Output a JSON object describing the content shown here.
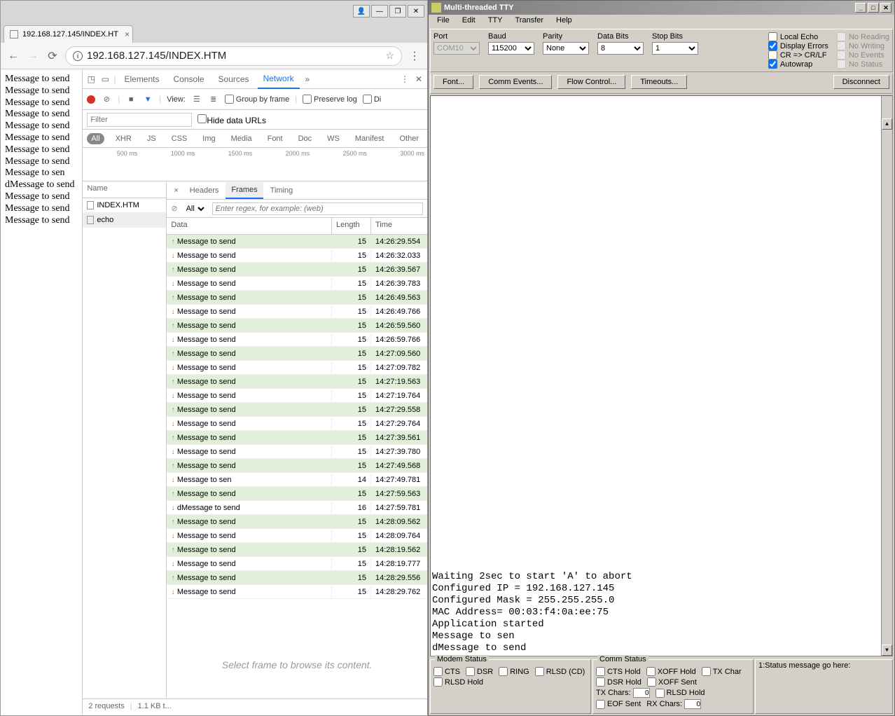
{
  "chrome": {
    "tab_title": "192.168.127.145/INDEX.HT",
    "url": "192.168.127.145/INDEX.HTM",
    "window_buttons": [
      "👤",
      "—",
      "❐",
      "✕"
    ],
    "nav": {
      "back": "←",
      "forward": "→",
      "reload": "⟳",
      "star": "☆",
      "menu": "⋮",
      "info": "ⓘ"
    },
    "page_lines": [
      "Message to send",
      "Message to send",
      "Message to send",
      "Message to send",
      "Message to send",
      "Message to send",
      "Message to send",
      "Message to send",
      "Message to sen",
      "dMessage to send",
      "Message to send",
      "Message to send",
      "Message to send"
    ]
  },
  "devtools": {
    "tabs": [
      "Elements",
      "Console",
      "Sources",
      "Network"
    ],
    "active_tab": "Network",
    "toolbar": {
      "view_label": "View:",
      "group_label": "Group by frame",
      "preserve_label": "Preserve log",
      "disable_label": "Di"
    },
    "filter_placeholder": "Filter",
    "hide_urls": "Hide data URLs",
    "type_filters": [
      "All",
      "XHR",
      "JS",
      "CSS",
      "Img",
      "Media",
      "Font",
      "Doc",
      "WS",
      "Manifest",
      "Other"
    ],
    "timeline": [
      "500 ms",
      "1000 ms",
      "1500 ms",
      "2000 ms",
      "2500 ms",
      "3000 ms"
    ],
    "request_header": "Name",
    "requests": [
      "INDEX.HTM",
      "echo"
    ],
    "selected_request": "echo",
    "detail_tabs": [
      "Headers",
      "Frames",
      "Timing"
    ],
    "active_detail": "Frames",
    "frame_filter": {
      "all": "All",
      "regex_placeholder": "Enter regex, for example: (web)"
    },
    "frame_headers": {
      "data": "Data",
      "length": "Length",
      "time": "Time"
    },
    "frames": [
      {
        "dir": "send",
        "data": "Message to send",
        "len": 15,
        "time": "14:26:29.554"
      },
      {
        "dir": "recv",
        "data": "Message to send",
        "len": 15,
        "time": "14:26:32.033"
      },
      {
        "dir": "send",
        "data": "Message to send",
        "len": 15,
        "time": "14:26:39.567"
      },
      {
        "dir": "recv",
        "data": "Message to send",
        "len": 15,
        "time": "14:26:39.783"
      },
      {
        "dir": "send",
        "data": "Message to send",
        "len": 15,
        "time": "14:26:49.563"
      },
      {
        "dir": "recv",
        "data": "Message to send",
        "len": 15,
        "time": "14:26:49.766"
      },
      {
        "dir": "send",
        "data": "Message to send",
        "len": 15,
        "time": "14:26:59.560"
      },
      {
        "dir": "recv",
        "data": "Message to send",
        "len": 15,
        "time": "14:26:59.766"
      },
      {
        "dir": "send",
        "data": "Message to send",
        "len": 15,
        "time": "14:27:09.560"
      },
      {
        "dir": "recv",
        "data": "Message to send",
        "len": 15,
        "time": "14:27:09.782"
      },
      {
        "dir": "send",
        "data": "Message to send",
        "len": 15,
        "time": "14:27:19.563"
      },
      {
        "dir": "recv",
        "data": "Message to send",
        "len": 15,
        "time": "14:27:19.764"
      },
      {
        "dir": "send",
        "data": "Message to send",
        "len": 15,
        "time": "14:27:29.558"
      },
      {
        "dir": "recv",
        "data": "Message to send",
        "len": 15,
        "time": "14:27:29.764"
      },
      {
        "dir": "send",
        "data": "Message to send",
        "len": 15,
        "time": "14:27:39.561"
      },
      {
        "dir": "recv",
        "data": "Message to send",
        "len": 15,
        "time": "14:27:39.780"
      },
      {
        "dir": "send",
        "data": "Message to send",
        "len": 15,
        "time": "14:27:49.568"
      },
      {
        "dir": "recv",
        "data": "Message to sen",
        "len": 14,
        "time": "14:27:49.781"
      },
      {
        "dir": "send",
        "data": "Message to send",
        "len": 15,
        "time": "14:27:59.563"
      },
      {
        "dir": "recv",
        "data": "dMessage to send",
        "len": 16,
        "time": "14:27:59.781"
      },
      {
        "dir": "send",
        "data": "Message to send",
        "len": 15,
        "time": "14:28:09.562"
      },
      {
        "dir": "recv",
        "data": "Message to send",
        "len": 15,
        "time": "14:28:09.764"
      },
      {
        "dir": "send",
        "data": "Message to send",
        "len": 15,
        "time": "14:28:19.562"
      },
      {
        "dir": "recv",
        "data": "Message to send",
        "len": 15,
        "time": "14:28:19.777"
      },
      {
        "dir": "send",
        "data": "Message to send",
        "len": 15,
        "time": "14:28:29.556"
      },
      {
        "dir": "recv",
        "data": "Message to send",
        "len": 15,
        "time": "14:28:29.762"
      }
    ],
    "placeholder": "Select frame to browse its content.",
    "status": {
      "requests": "2 requests",
      "transfer": "1.1 KB t..."
    }
  },
  "tty": {
    "title": "Multi-threaded TTY",
    "menu": [
      "File",
      "Edit",
      "TTY",
      "Transfer",
      "Help"
    ],
    "port": {
      "label": "Port",
      "value": "COM10"
    },
    "baud": {
      "label": "Baud",
      "value": "115200"
    },
    "parity": {
      "label": "Parity",
      "value": "None"
    },
    "databits": {
      "label": "Data Bits",
      "value": "8"
    },
    "stopbits": {
      "label": "Stop Bits",
      "value": "1"
    },
    "checks1": [
      {
        "label": "Local Echo",
        "checked": false,
        "enabled": true
      },
      {
        "label": "Display Errors",
        "checked": true,
        "enabled": true
      },
      {
        "label": "CR => CR/LF",
        "checked": false,
        "enabled": true
      },
      {
        "label": "Autowrap",
        "checked": true,
        "enabled": true
      }
    ],
    "checks2": [
      {
        "label": "No Reading",
        "checked": false,
        "enabled": false
      },
      {
        "label": "No Writing",
        "checked": false,
        "enabled": false
      },
      {
        "label": "No Events",
        "checked": false,
        "enabled": false
      },
      {
        "label": "No Status",
        "checked": false,
        "enabled": false
      }
    ],
    "buttons": [
      "Font...",
      "Comm Events...",
      "Flow Control...",
      "Timeouts..."
    ],
    "disconnect": "Disconnect",
    "terminal": [
      "Waiting 2sec to start 'A' to abort",
      "Configured IP = 192.168.127.145",
      "Configured Mask = 255.255.255.0",
      "MAC Address= 00:03:f4:0a:ee:75",
      "Application started",
      "Message to sen",
      "dMessage to send"
    ],
    "modem": {
      "legend": "Modem Status",
      "items": [
        "CTS",
        "DSR",
        "RING",
        "RLSD (CD)",
        "RLSD Hold"
      ]
    },
    "comm": {
      "legend": "Comm Status",
      "row1": [
        "CTS Hold",
        "XOFF Hold",
        "TX Char"
      ],
      "row2": [
        "DSR Hold",
        "XOFF Sent"
      ],
      "txchars_label": "TX Chars:",
      "txchars_val": "0",
      "row3": [
        "RLSD Hold",
        "EOF Sent"
      ],
      "rxchars_label": "RX Chars:",
      "rxchars_val": "0"
    },
    "status_msg": "1:Status message go here:"
  }
}
